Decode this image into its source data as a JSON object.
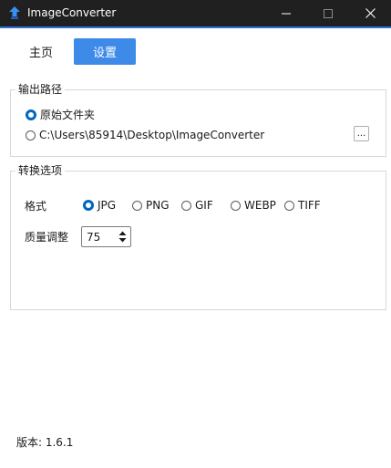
{
  "window": {
    "title": "ImageConverter",
    "accent": "#2f6fd6",
    "app_icon": "blue-arrow-up-icon",
    "controls": [
      "minimize-icon",
      "maximize-icon",
      "close-icon"
    ]
  },
  "nav": {
    "tabs": [
      {
        "label": "主页",
        "active": false
      },
      {
        "label": "设置",
        "active": true
      }
    ],
    "active_color": "#3d8ae8"
  },
  "output_path": {
    "title": "输出路径",
    "options": [
      {
        "label": "原始文件夹",
        "selected": true
      },
      {
        "label": "C:\\Users\\85914\\Desktop\\ImageConverter",
        "selected": false
      }
    ],
    "browse_label": "..."
  },
  "convert_options": {
    "title": "转换选项",
    "format_label": "格式",
    "formats": [
      {
        "label": "JPG",
        "selected": true
      },
      {
        "label": "PNG",
        "selected": false
      },
      {
        "label": "GIF",
        "selected": false
      },
      {
        "label": "WEBP",
        "selected": false
      },
      {
        "label": "TIFF",
        "selected": false
      }
    ],
    "quality_label": "质量调整",
    "quality_value": "75"
  },
  "version_text": "版本: 1.6.1"
}
